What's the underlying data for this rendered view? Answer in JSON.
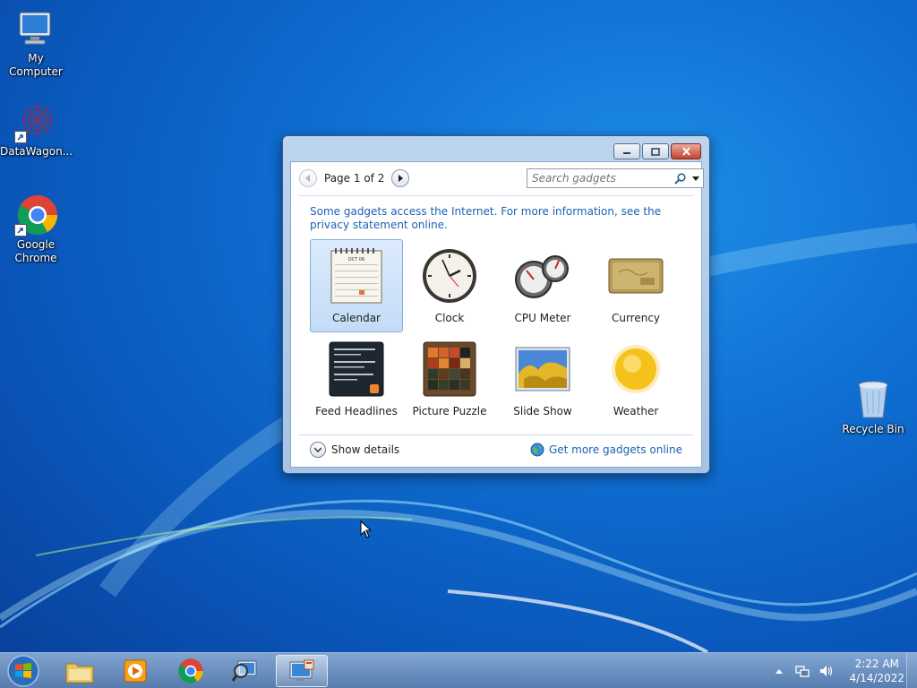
{
  "desktop": {
    "icons": [
      {
        "label": "My Computer",
        "icon": "computer-icon"
      },
      {
        "label": "DataWagon...",
        "icon": "datawagon-icon"
      },
      {
        "label": "Google Chrome",
        "icon": "chrome-icon"
      },
      {
        "label": "Recycle Bin",
        "icon": "recycle-bin-icon"
      }
    ]
  },
  "gadgets_window": {
    "controls": [
      "minimize",
      "maximize",
      "close"
    ],
    "pager": {
      "label": "Page 1 of 2"
    },
    "search": {
      "placeholder": "Search gadgets",
      "value": ""
    },
    "info_text": "Some gadgets access the Internet.  For more information, see the privacy statement online.",
    "gadgets": [
      {
        "name": "Calendar",
        "icon": "calendar-icon",
        "selected": true
      },
      {
        "name": "Clock",
        "icon": "clock-icon"
      },
      {
        "name": "CPU Meter",
        "icon": "cpu-meter-icon"
      },
      {
        "name": "Currency",
        "icon": "currency-icon"
      },
      {
        "name": "Feed Headlines",
        "icon": "feed-headlines-icon"
      },
      {
        "name": "Picture Puzzle",
        "icon": "picture-puzzle-icon"
      },
      {
        "name": "Slide Show",
        "icon": "slide-show-icon"
      },
      {
        "name": "Weather",
        "icon": "weather-icon"
      }
    ],
    "calendar_month": "OCT 06",
    "footer": {
      "show_details": "Show details",
      "get_more": "Get more gadgets online"
    }
  },
  "taskbar": {
    "pinned": [
      "start-button",
      "file-explorer-icon",
      "media-player-icon",
      "chrome-icon",
      "search-tool-icon",
      "gadgets-icon"
    ],
    "clock": {
      "time": "2:22 AM",
      "date": "4/14/2022"
    }
  },
  "colors": {
    "accent": "#1b61b4",
    "desktop": "#0f6fd2"
  }
}
